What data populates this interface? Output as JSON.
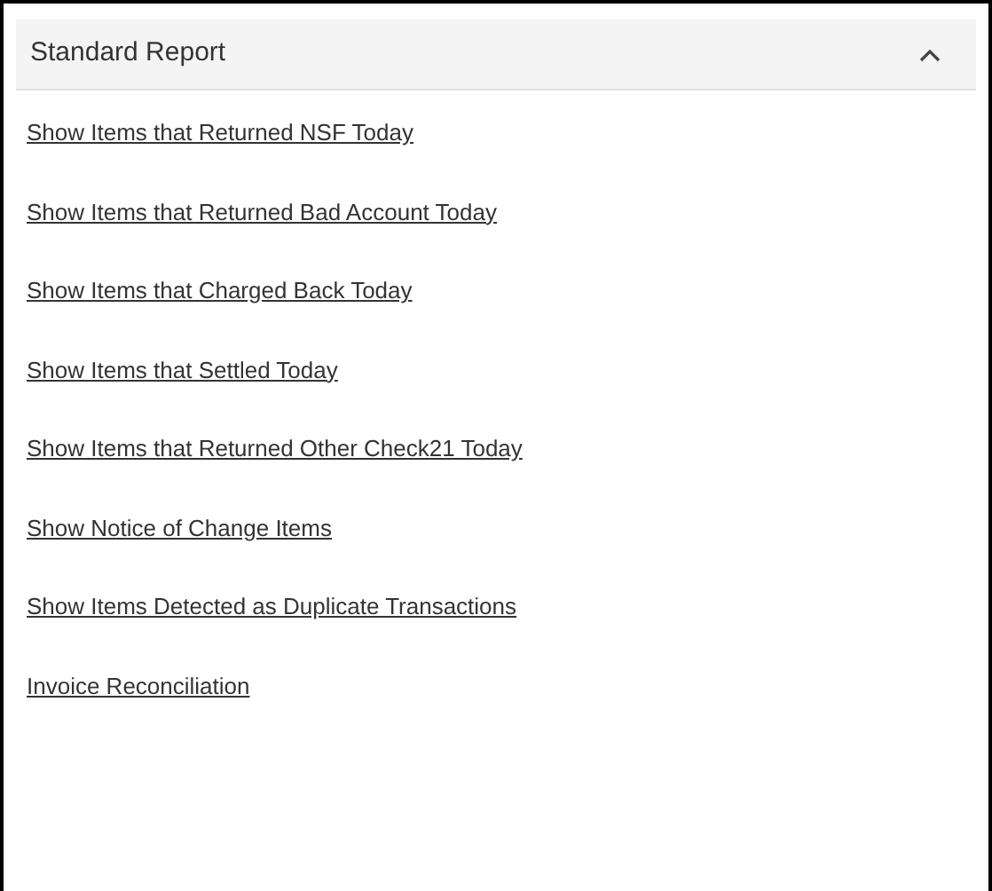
{
  "panel": {
    "title": "Standard Report",
    "expanded": true,
    "links": [
      "Show Items that Returned NSF Today",
      "Show Items that Returned Bad Account Today",
      "Show Items that Charged Back Today",
      "Show Items that Settled Today",
      "Show Items that Returned Other Check21 Today",
      "Show Notice of Change Items",
      "Show Items Detected as Duplicate Transactions",
      "Invoice Reconciliation"
    ]
  }
}
